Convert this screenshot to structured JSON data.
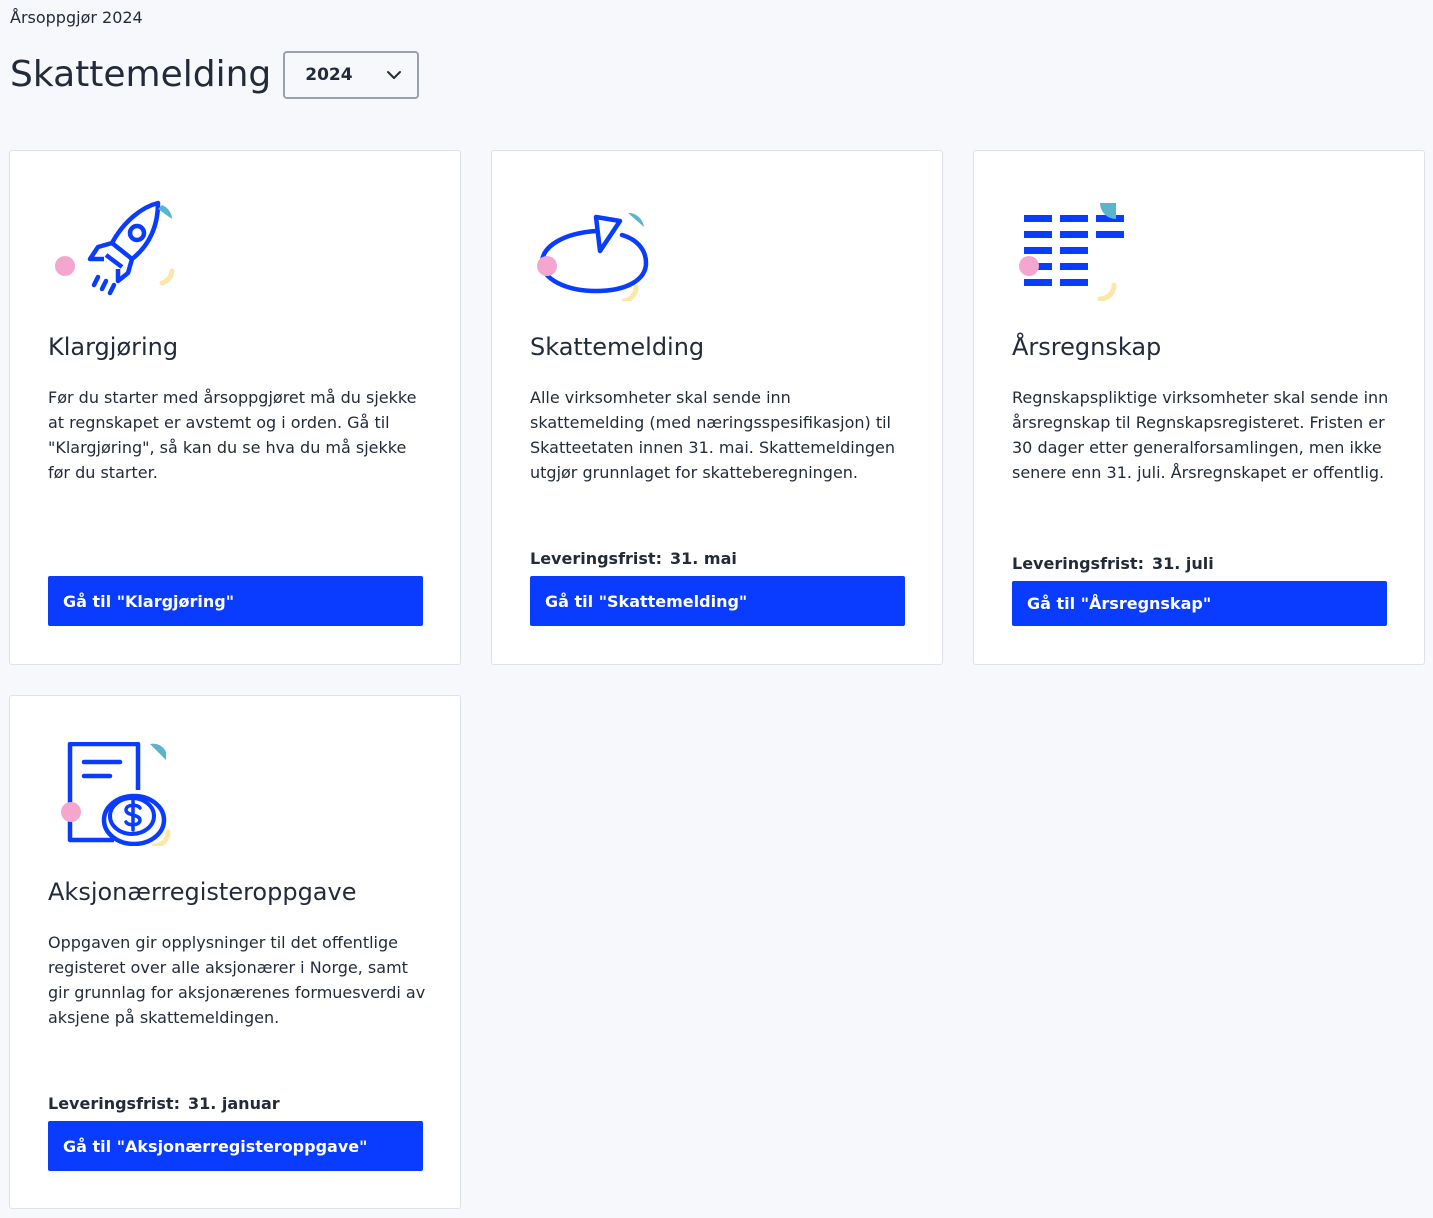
{
  "breadcrumb": "Årsoppgjør 2024",
  "page_title": "Skattemelding",
  "year_select": {
    "value": "2024"
  },
  "colors": {
    "accent": "#0a3cff",
    "pink": "#f5a6cf",
    "teal": "#5ab3cf",
    "yellow": "#fde7a6"
  },
  "cards": [
    {
      "icon": "rocket-icon",
      "title": "Klargjøring",
      "description": "Før du starter med årsoppgjøret må du sjekke at regnskapet er avstemt og i orden. Gå til \"Klargjøring\", så kan du se hva du må sjekke før du starter.",
      "button": "Gå til \"Klargjøring\""
    },
    {
      "icon": "pie-chart-icon",
      "title": "Skattemelding",
      "description": "Alle virksomheter skal sende inn skattemelding (med næringsspesifikasjon) til Skatteetaten innen 31. mai. Skattemeldingen utgjør grunnlaget for skatteberegningen.",
      "deadline_label": "Leveringsfrist:",
      "deadline_value": "31. mai",
      "button": "Gå til \"Skattemelding\""
    },
    {
      "icon": "ledger-icon",
      "title": "Årsregnskap",
      "description": "Regnskapspliktige virksomheter skal sende inn årsregnskap til Regnskapsregisteret. Fristen er 30 dager etter generalforsamlingen, men ikke senere enn 31. juli. Årsregnskapet er offentlig.",
      "deadline_label": "Leveringsfrist:",
      "deadline_value": "31. juli",
      "button": "Gå til \"Årsregnskap\""
    },
    {
      "icon": "document-coin-icon",
      "title": "Aksjonærregisteroppgave",
      "description": "Oppgaven gir opplysninger til det offentlige registeret over alle aksjonærer i Norge, samt gir grunnlag for aksjonærenes formuesverdi av aksjene på skattemeldingen.",
      "deadline_label": "Leveringsfrist:",
      "deadline_value": "31. januar",
      "button": "Gå til \"Aksjonærregisteroppgave\""
    }
  ]
}
